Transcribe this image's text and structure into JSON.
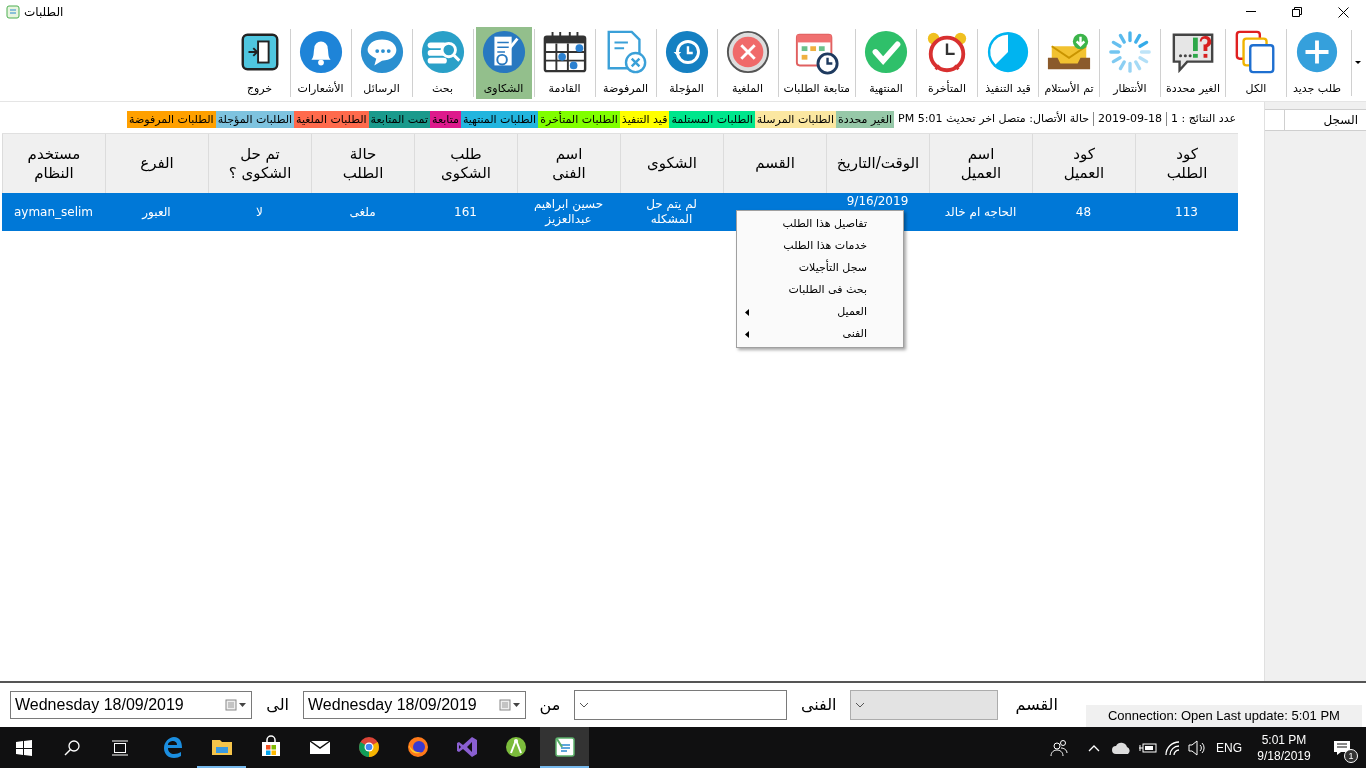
{
  "window": {
    "title": "الطلبات"
  },
  "toolbar": {
    "items": [
      {
        "label": "طلب جديد",
        "kind": "plus",
        "selected": false
      },
      {
        "label": "الكل",
        "kind": "stack",
        "selected": false
      },
      {
        "label": "الغير محددة",
        "kind": "bubble-alert",
        "selected": false
      },
      {
        "label": "الأنتظار",
        "kind": "spinner",
        "selected": false
      },
      {
        "label": "تم الأستلام",
        "kind": "inbox",
        "selected": false
      },
      {
        "label": "قيد التنفيذ",
        "kind": "pie",
        "selected": false
      },
      {
        "label": "المتأخرة",
        "kind": "alarm",
        "selected": false
      },
      {
        "label": "المنتهية",
        "kind": "check",
        "selected": false
      },
      {
        "label": "متابعة الطلبات",
        "kind": "calendar-clock",
        "selected": false
      },
      {
        "label": "الملغية",
        "kind": "cancel",
        "selected": false
      },
      {
        "label": "المؤجلة",
        "kind": "history",
        "selected": false
      },
      {
        "label": "المرفوضة",
        "kind": "doc-x",
        "selected": false
      },
      {
        "label": "القادمة",
        "kind": "calendar",
        "selected": false
      },
      {
        "label": "الشكاوى",
        "kind": "complaint",
        "selected": true
      },
      {
        "label": "بحث",
        "kind": "search",
        "selected": false
      },
      {
        "label": "الرسائل",
        "kind": "chat",
        "selected": false
      },
      {
        "label": "الأشعارات",
        "kind": "bell",
        "selected": false
      },
      {
        "label": "خروج",
        "kind": "exit",
        "selected": false
      }
    ]
  },
  "status": {
    "count": "عدد النتائج : 1",
    "date": "2019-09-18",
    "connection": "حالة الأتصال:  متصل اخر تحديث PM 5:01"
  },
  "legend": [
    {
      "label": "الغير محددة",
      "color": "#96c8a8"
    },
    {
      "label": "الطلبات المرسلة",
      "color": "#fbe7a1"
    },
    {
      "label": "الطلبات المستلمة",
      "color": "#00e68c"
    },
    {
      "label": "قيد التنفيذ",
      "color": "#ffff00"
    },
    {
      "label": "الطلبات المتأخرة",
      "color": "#80ff00"
    },
    {
      "label": "الطلبات المنتهية",
      "color": "#22b5de"
    },
    {
      "label": "متابعة",
      "color": "#de1a8c"
    },
    {
      "label": "تمت المتابعة",
      "color": "#1a9a8c"
    },
    {
      "label": "الطلبات الملغية",
      "color": "#ff6a4c"
    },
    {
      "label": "الطلبات المؤجلة",
      "color": "#7ec3df"
    },
    {
      "label": "الطلبات المرفوضة",
      "color": "#ffa000"
    }
  ],
  "side_panel": {
    "header": "السجل"
  },
  "table": {
    "columns": [
      "كود\nالطلب",
      "كود\nالعميل",
      "اسم\nالعميل",
      "الوقت/التاريخ",
      "القسم",
      "الشكوى",
      "اسم\nالفنى",
      "طلب\nالشكوى",
      "حالة\nالطلب",
      "تم حل\nالشكوى ؟",
      "الفرع",
      "مستخدم\nالنظام"
    ],
    "rows": [
      {
        "selected": true,
        "cells": [
          "113",
          "48",
          "الحاجه ام خالد",
          "9/16/2019",
          null,
          "لم يتم حل\nالمشكله",
          "حسين ابراهيم\nعبدالعزيز",
          "161",
          "ملغى",
          "لا",
          "العبور",
          "ayman_selim"
        ]
      }
    ]
  },
  "context_menu": {
    "items": [
      {
        "label": "تفاصيل هذا الطلب",
        "kind": "action"
      },
      {
        "label": "خدمات هذا الطلب",
        "kind": "action"
      },
      {
        "label": "سجل التأجيلات",
        "kind": "action"
      },
      {
        "label": "بحث فى الطلبات",
        "kind": "action"
      },
      {
        "label": "العميل",
        "kind": "submenu"
      },
      {
        "label": "الفنى",
        "kind": "submenu"
      }
    ]
  },
  "filters": {
    "to_date": "Wednesday 18/09/2019",
    "to_label": "الى",
    "from_date": "Wednesday 18/09/2019",
    "from_label": "من",
    "technician_label": "الفنى",
    "technician_disabled": false,
    "department_label": "القسم",
    "department_disabled": true
  },
  "status_bar": "Connection: Open Last update: 5:01 PM",
  "taskbar": {
    "apps": [
      {
        "kind": "edge",
        "active": false
      },
      {
        "kind": "folder",
        "active": true
      },
      {
        "kind": "store",
        "active": false
      },
      {
        "kind": "mail",
        "active": false
      },
      {
        "kind": "chrome",
        "active": false
      },
      {
        "kind": "firefox",
        "active": false
      },
      {
        "kind": "visual-studio",
        "active": false
      },
      {
        "kind": "android",
        "active": false
      },
      {
        "kind": "app",
        "active": true
      }
    ],
    "language": "ENG",
    "time": "5:01 PM",
    "date": "9/18/2019",
    "notifications": "1"
  }
}
